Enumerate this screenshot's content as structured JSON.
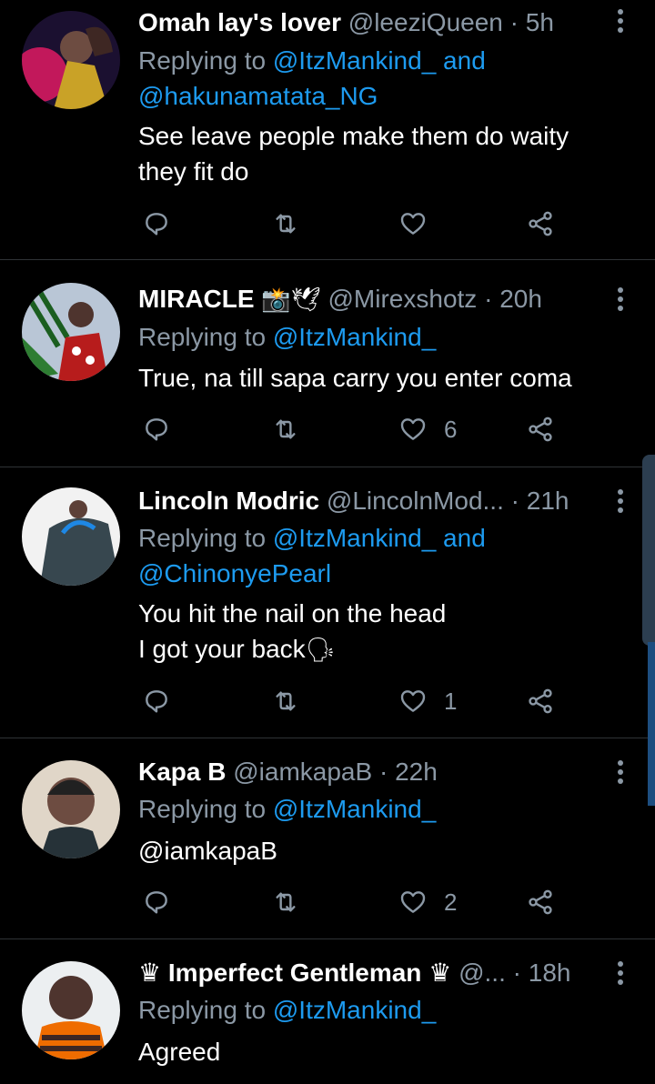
{
  "tweets": [
    {
      "name": "Omah lay's lover",
      "handle": "@leeziQueen",
      "dot": "·",
      "time": "5h",
      "replying_prefix": "Replying to",
      "reply_line1": "@ItzMankind_ and",
      "reply_line2": "@hakunamatata_NG",
      "body_line1": "See leave people make them do waity",
      "body_line2": "they fit do",
      "likes": ""
    },
    {
      "name": "MIRACLE",
      "name_emoji": "📸🕊",
      "handle": "@Mirexshotz",
      "dot": "·",
      "time": "20h",
      "replying_prefix": "Replying to",
      "reply_line1": "@ItzMankind_",
      "body_line1": "True, na till sapa carry you enter coma",
      "likes": "6"
    },
    {
      "name": "Lincoln Modric",
      "handle": "@LincolnMod...",
      "dot": "·",
      "time": "21h",
      "replying_prefix": "Replying to",
      "reply_line1": "@ItzMankind_ and",
      "reply_line2": "@ChinonyePearl",
      "body_line1": "You hit the nail on the head",
      "body_line2": "I got your back",
      "body_emoji": "🗣",
      "likes": "1"
    },
    {
      "name": "Kapa B",
      "handle": "@iamkapaB",
      "dot": "·",
      "time": "22h",
      "replying_prefix": "Replying to",
      "reply_line1": "@ItzMankind_",
      "body_link": "@iamkapaB",
      "likes": "2"
    },
    {
      "name": "Imperfect Gentleman",
      "crown": "♛",
      "handle": "@...",
      "dot": "·",
      "time": "18h",
      "replying_prefix": "Replying to",
      "reply_line1": "@ItzMankind_",
      "body_line1": "Agreed"
    }
  ],
  "colors": {
    "link": "#1d9bf0",
    "muted": "#8b98a5",
    "divider": "#2f3336"
  },
  "icons": [
    "reply-icon",
    "retweet-icon",
    "like-icon",
    "share-icon",
    "more-vertical-icon"
  ]
}
